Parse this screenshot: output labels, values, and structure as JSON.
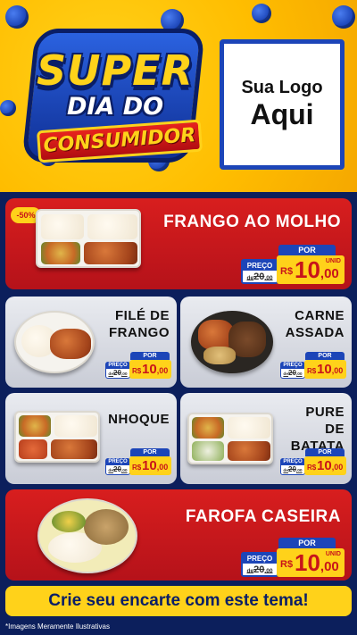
{
  "header": {
    "line1": "SUPER",
    "line2": "DIA DO",
    "line3": "CONSUMIDOR",
    "logo_line1": "Sua Logo",
    "logo_line2": "Aqui"
  },
  "price_labels": {
    "por": "POR",
    "preco": "PREÇO",
    "de": "de",
    "currency": "R$",
    "unit": "UNID"
  },
  "products": [
    {
      "name": "FRANGO AO MOLHO",
      "discount": "-50%",
      "old_price": "20",
      "old_cents": ",00",
      "price": "10",
      "cents": ",00"
    },
    {
      "name": "FILÉ DE FRANGO",
      "old_price": "20",
      "old_cents": ",00",
      "price": "10",
      "cents": ",00"
    },
    {
      "name": "CARNE ASSADA",
      "old_price": "20",
      "old_cents": ",00",
      "price": "10",
      "cents": ",00"
    },
    {
      "name": "NHOQUE",
      "old_price": "20",
      "old_cents": ",00",
      "price": "10",
      "cents": ",00"
    },
    {
      "name": "PURE DE BATATA",
      "old_price": "20",
      "old_cents": ",00",
      "price": "10",
      "cents": ",00"
    },
    {
      "name": "FAROFA CASEIRA",
      "old_price": "20",
      "old_cents": ",00",
      "price": "10",
      "cents": ",00"
    }
  ],
  "cta": "Crie seu encarte com este tema!",
  "disclaimer": "*Imagens Meramente Ilustrativas",
  "colors": {
    "yellow": "#ffd21a",
    "red": "#d81e1e",
    "blue": "#1c45b8",
    "navy": "#0c1f5c"
  }
}
